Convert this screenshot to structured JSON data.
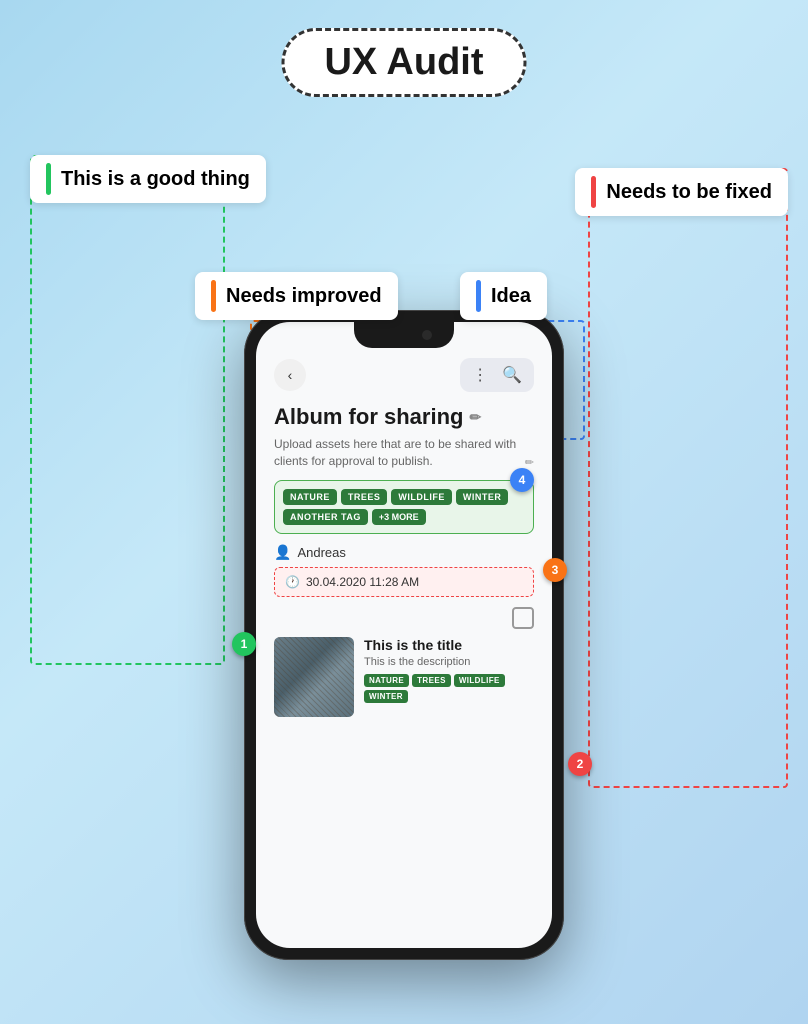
{
  "title": "UX Audit",
  "annotations": {
    "good": "This is a good thing",
    "fix": "Needs to be fixed",
    "improve": "Needs improved",
    "idea": "Idea"
  },
  "phone": {
    "album_title": "Album for sharing",
    "album_desc": "Upload assets here that are to be shared with clients for approval to publish.",
    "tags": [
      "NATURE",
      "TREES",
      "WILDLIFE",
      "WINTER",
      "ANOTHER TAG",
      "+3 MORE"
    ],
    "user": "Andreas",
    "date": "30.04.2020 11:28 AM",
    "media_title": "This is the title",
    "media_desc": "This is the description",
    "media_tags": [
      "NATURE",
      "TREES",
      "WILDLIFE",
      "WINTER"
    ]
  },
  "badges": {
    "1": "1",
    "2": "2",
    "3": "3",
    "4": "4"
  },
  "colors": {
    "good": "#22c55e",
    "fix": "#ef4444",
    "improve": "#f97316",
    "idea": "#3b82f6",
    "badge_green": "#22c55e",
    "badge_red": "#ef4444",
    "badge_orange": "#f97316",
    "badge_blue": "#3b82f6"
  }
}
